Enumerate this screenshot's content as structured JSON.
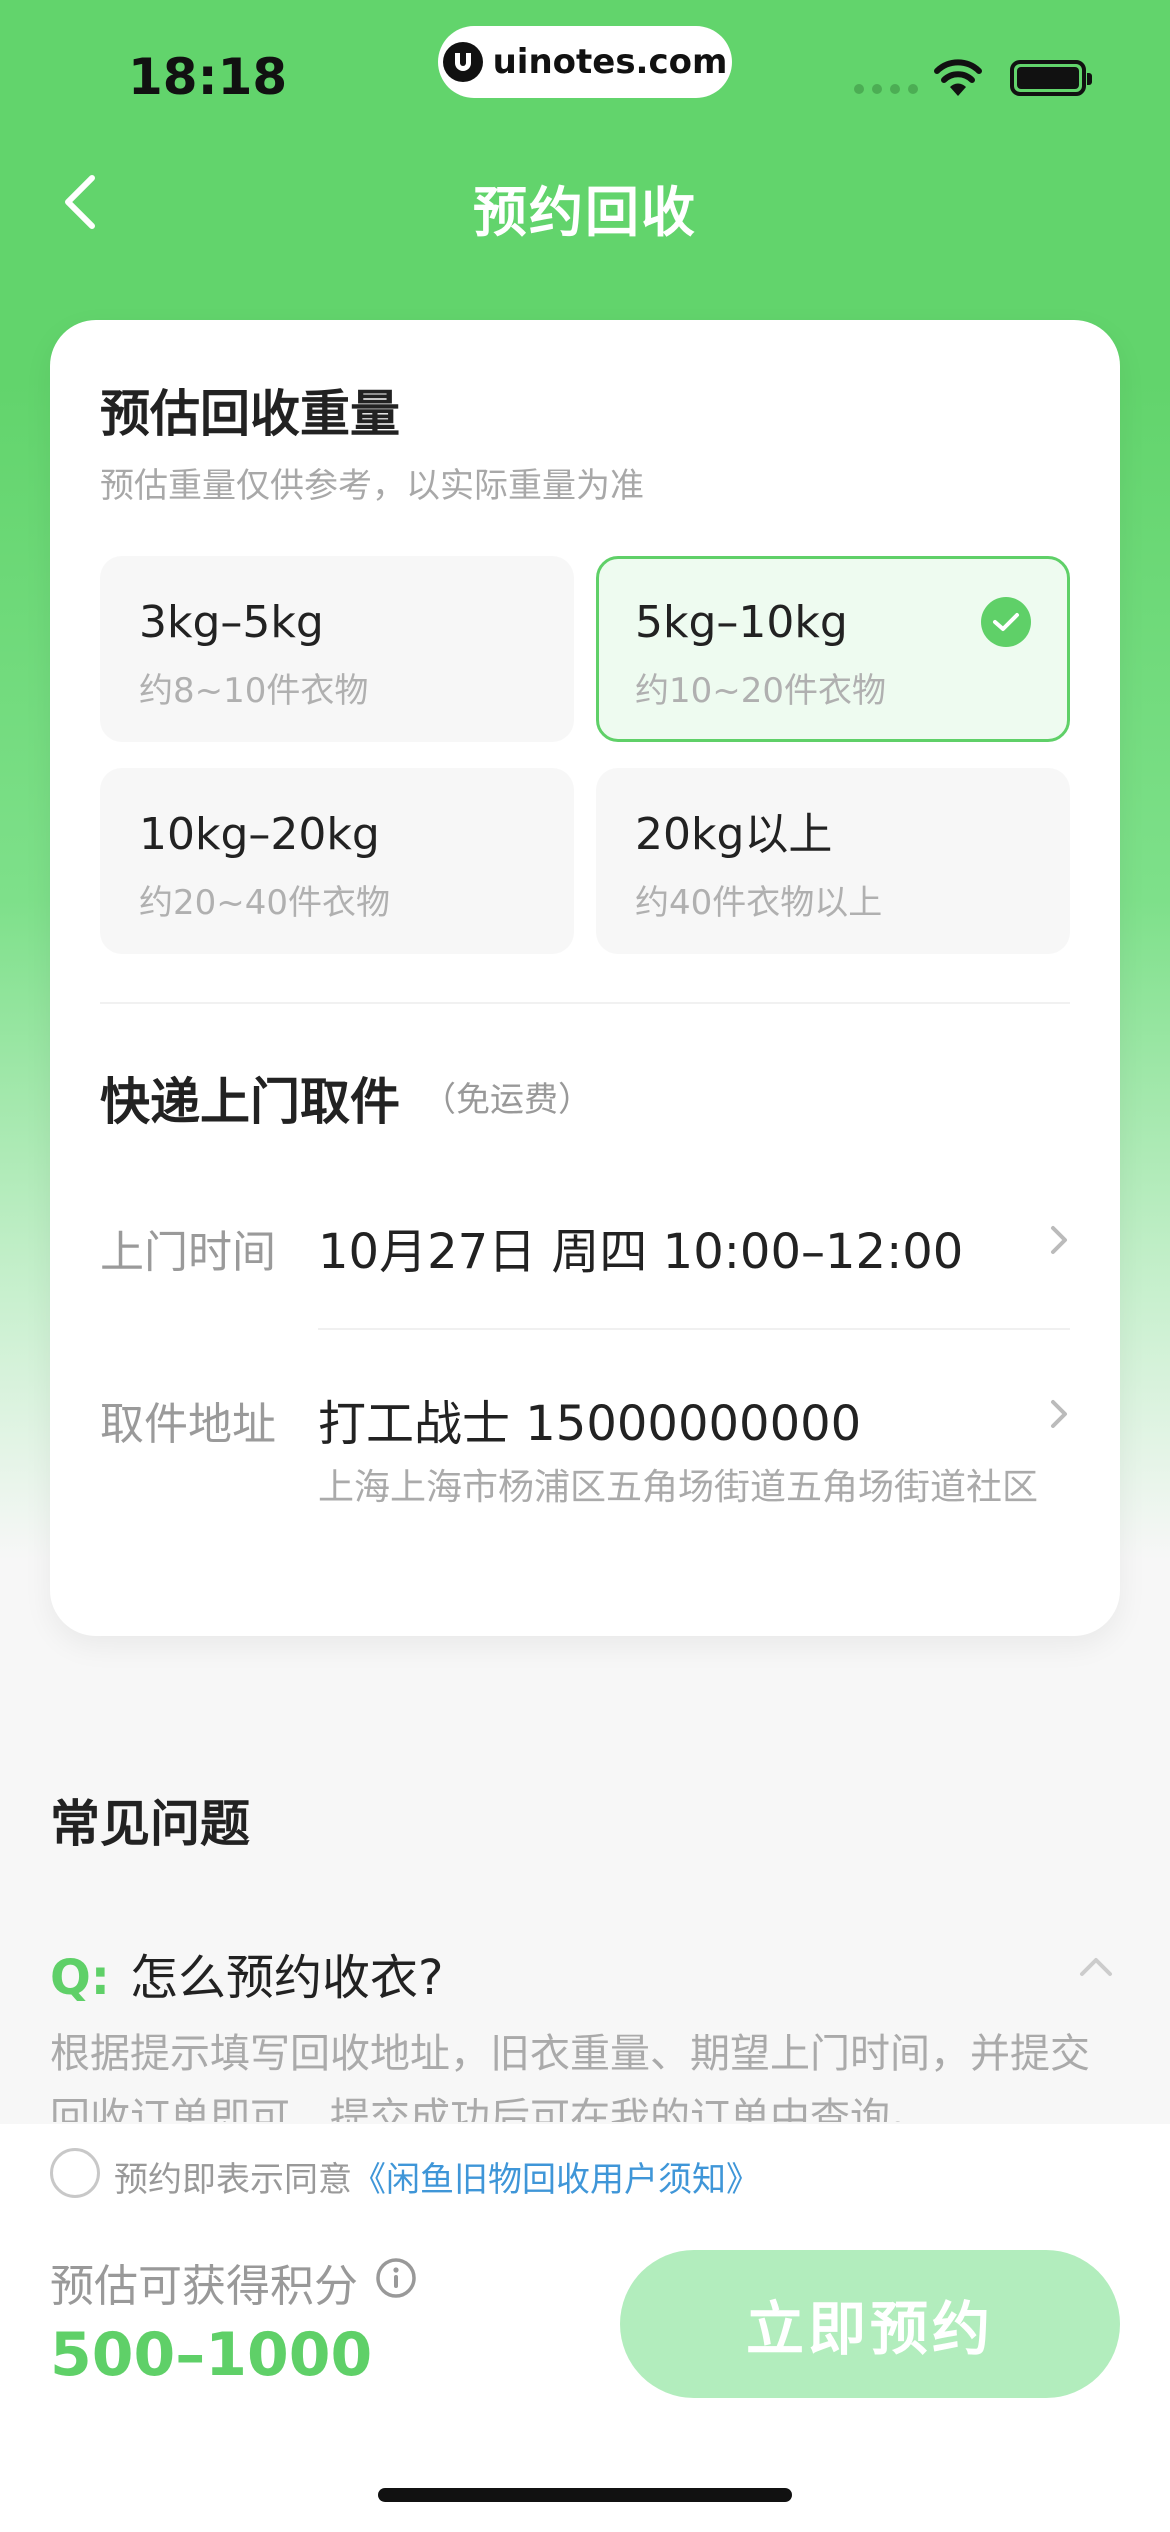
{
  "status_bar": {
    "time": "18:18",
    "url": "uinotes.com"
  },
  "nav": {
    "title": "预约回收"
  },
  "weight": {
    "title": "预估回收重量",
    "subtitle": "预估重量仅供参考，以实际重量为准",
    "options": [
      {
        "label": "3kg–5kg",
        "sub": "约8~10件衣物",
        "selected": false
      },
      {
        "label": "5kg–10kg",
        "sub": "约10~20件衣物",
        "selected": true
      },
      {
        "label": "10kg–20kg",
        "sub": "约20~40件衣物",
        "selected": false
      },
      {
        "label": "20kg以上",
        "sub": "约40件衣物以上",
        "selected": false
      }
    ]
  },
  "pickup": {
    "title": "快递上门取件",
    "note": "（免运费）",
    "time_label": "上门时间",
    "time_value": "10月27日 周四 10:00–12:00",
    "address_label": "取件地址",
    "address_contact": "打工战士 15000000000",
    "address_detail": "上海上海市杨浦区五角场街道五角场街道社区"
  },
  "faq": {
    "title": "常见问题",
    "q_prefix": "Q:",
    "question": "怎么预约收衣?",
    "answer": "根据提示填写回收地址，旧衣重量、期望上门时间，并提交回收订单即可，提交成功后可在我的订单中查询。"
  },
  "footer": {
    "agree_text": "预约即表示同意",
    "agree_link": "《闲鱼旧物回收用户须知》",
    "points_label": "预估可获得积分",
    "points_value": "500–1000",
    "book_button": "立即预约"
  },
  "colors": {
    "accent": "#5fd068",
    "link": "#3f96d8",
    "button_disabled": "#b2edbd"
  }
}
